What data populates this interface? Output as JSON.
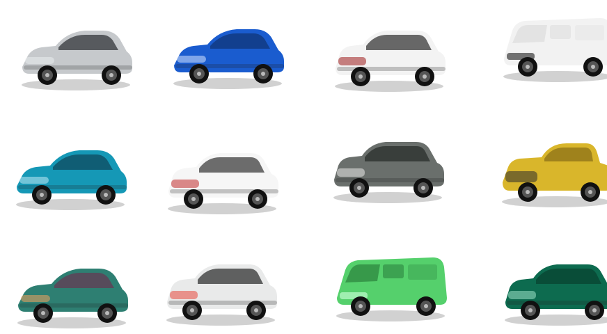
{
  "gallery": {
    "cars": [
      {
        "kind": "hatchback",
        "body": "#c6c9cc",
        "roof": "#1b1f24",
        "accent": "#e9ecef"
      },
      {
        "kind": "hatchback",
        "body": "#1a5ccf",
        "roof": "#0e2f6b",
        "accent": "#d6e4ff"
      },
      {
        "kind": "suv",
        "body": "#f3f3f3",
        "roof": "#1b1b1b",
        "accent": "#9c1c1c"
      },
      {
        "kind": "van",
        "body": "#f2f2f2",
        "roof": "#d7d7d7",
        "accent": "#2b2b2b"
      },
      {
        "kind": "hatchback",
        "body": "#1598b6",
        "roof": "#0e3e52",
        "accent": "#bfe9f4"
      },
      {
        "kind": "suv",
        "body": "#f6f6f6",
        "roof": "#222222",
        "accent": "#c12c2c"
      },
      {
        "kind": "suv",
        "body": "#6a6f6c",
        "roof": "#1f2322",
        "accent": "#e7e7e7"
      },
      {
        "kind": "pickup",
        "body": "#d9b62b",
        "roof": "#6f5710",
        "accent": "#2b2b2b"
      },
      {
        "kind": "hatchback",
        "body": "#2e7f72",
        "roof": "#6d2f4f",
        "accent": "#f0a25f"
      },
      {
        "kind": "suv",
        "body": "#e9eaea",
        "roof": "#151515",
        "accent": "#e8473d"
      },
      {
        "kind": "van",
        "body": "#55d06c",
        "roof": "#1f6b30",
        "accent": "#c8ffd6"
      },
      {
        "kind": "suv",
        "body": "#0d6b4f",
        "roof": "#083d2c",
        "accent": "#9fe2c9"
      }
    ]
  }
}
